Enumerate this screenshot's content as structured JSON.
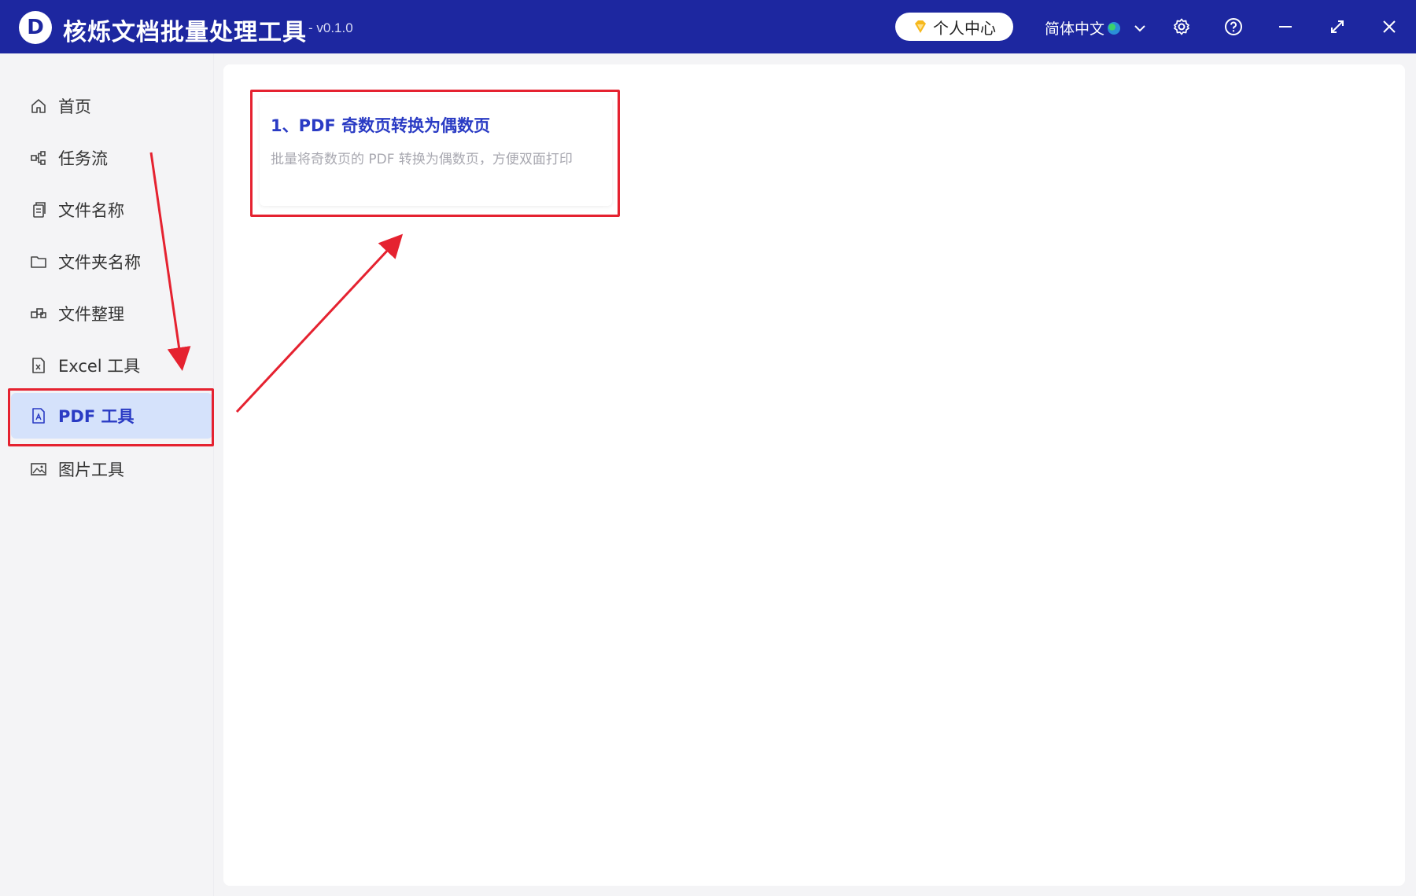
{
  "app": {
    "title": "核烁文档批量处理工具",
    "version": "- v0.1.0",
    "logo_letter": "D"
  },
  "titlebar": {
    "user_center_label": "个人中心",
    "language_label": "简体中文",
    "icons": [
      "diamond-icon",
      "globe-icon",
      "chevron-down-icon",
      "gear-icon",
      "help-icon",
      "minimize-icon",
      "maximize-icon",
      "close-icon"
    ]
  },
  "sidebar": {
    "items": [
      {
        "label": "首页",
        "icon": "home-icon"
      },
      {
        "label": "任务流",
        "icon": "workflow-icon"
      },
      {
        "label": "文件名称",
        "icon": "file-copy-icon"
      },
      {
        "label": "文件夹名称",
        "icon": "folder-icon"
      },
      {
        "label": "文件整理",
        "icon": "organize-icon"
      },
      {
        "label": "Excel 工具",
        "icon": "excel-file-icon"
      },
      {
        "label": "PDF 工具",
        "icon": "pdf-file-icon",
        "active": true
      },
      {
        "label": "图片工具",
        "icon": "image-icon"
      }
    ]
  },
  "main": {
    "cards": [
      {
        "title": "1、PDF 奇数页转换为偶数页",
        "description": "批量将奇数页的 PDF 转换为偶数页，方便双面打印"
      }
    ]
  },
  "colors": {
    "titlebar_bg": "#1d27a0",
    "accent": "#2a3bc4",
    "active_bg": "#d5e2fb",
    "annotation_red": "#e52230"
  }
}
